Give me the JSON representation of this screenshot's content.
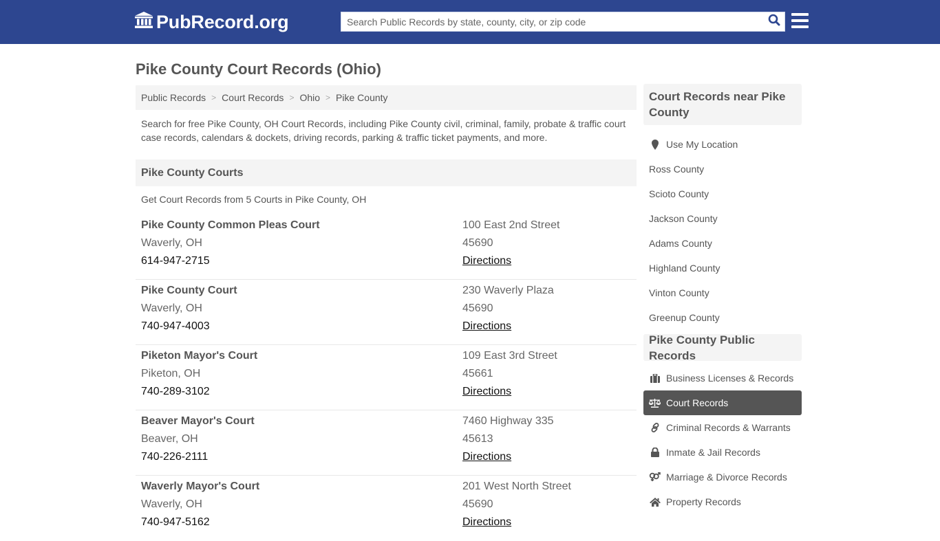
{
  "header": {
    "logo_text": "PubRecord.org",
    "logo_icon": "courthouse-icon",
    "search_placeholder": "Search Public Records by state, county, city, or zip code",
    "search_value": "",
    "search_icon": "search-icon",
    "menu_icon": "hamburger-menu-icon"
  },
  "colors": {
    "header_bg": "#2d4690",
    "search_icon": "#2d4690",
    "active_item_bg": "#555555",
    "panel_bg": "#f4f4f4"
  },
  "main": {
    "title": "Pike County Court Records (Ohio)",
    "breadcrumb": [
      {
        "label": "Public Records"
      },
      {
        "label": "Court Records"
      },
      {
        "label": "Ohio"
      },
      {
        "label": "Pike County"
      }
    ],
    "intro": "Search for free Pike County, OH Court Records, including Pike County civil, criminal, family, probate & traffic court case records, calendars & dockets, driving records, parking & traffic ticket payments, and more.",
    "section_title": "Pike County Courts",
    "section_subtitle": "Get Court Records from 5 Courts in Pike County, OH",
    "courts": [
      {
        "name": "Pike County Common Pleas Court",
        "city": "Waverly, OH",
        "phone": "614-947-2715",
        "address": "100 East 2nd Street",
        "zip": "45690",
        "directions": "Directions"
      },
      {
        "name": "Pike County Court",
        "city": "Waverly, OH",
        "phone": "740-947-4003",
        "address": "230 Waverly Plaza",
        "zip": "45690",
        "directions": "Directions"
      },
      {
        "name": "Piketon Mayor's Court",
        "city": "Piketon, OH",
        "phone": "740-289-3102",
        "address": "109 East 3rd Street",
        "zip": "45661",
        "directions": "Directions"
      },
      {
        "name": "Beaver Mayor's Court",
        "city": "Beaver, OH",
        "phone": "740-226-2111",
        "address": "7460 Highway 335",
        "zip": "45613",
        "directions": "Directions"
      },
      {
        "name": "Waverly Mayor's Court",
        "city": "Waverly, OH",
        "phone": "740-947-5162",
        "address": "201 West North Street",
        "zip": "45690",
        "directions": "Directions"
      }
    ]
  },
  "sidebar": {
    "nearby_title": "Court Records near Pike County",
    "use_location": {
      "label": "Use My Location",
      "icon": "map-marker-icon"
    },
    "nearby": [
      {
        "label": "Ross County"
      },
      {
        "label": "Scioto County"
      },
      {
        "label": "Jackson County"
      },
      {
        "label": "Adams County"
      },
      {
        "label": "Highland County"
      },
      {
        "label": "Vinton County"
      },
      {
        "label": "Greenup County"
      }
    ],
    "records_title": "Pike County Public Records",
    "records": [
      {
        "label": "Business Licenses & Records",
        "icon": "briefcase-icon",
        "active": false
      },
      {
        "label": "Court Records",
        "icon": "balance-scale-icon",
        "active": true
      },
      {
        "label": "Criminal Records & Warrants",
        "icon": "link-icon",
        "active": false
      },
      {
        "label": "Inmate & Jail Records",
        "icon": "lock-icon",
        "active": false
      },
      {
        "label": "Marriage & Divorce Records",
        "icon": "venus-mars-icon",
        "active": false
      },
      {
        "label": "Property Records",
        "icon": "home-icon",
        "active": false
      }
    ]
  }
}
